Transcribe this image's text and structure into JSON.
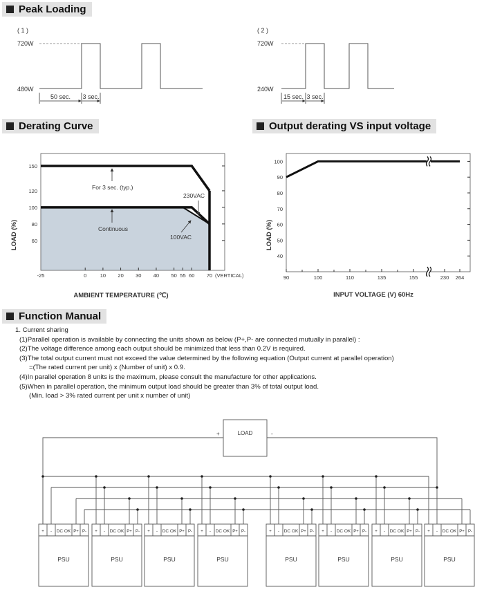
{
  "sections": {
    "peak_loading": "Peak Loading",
    "derating_curve": "Derating Curve",
    "output_derating": "Output derating VS input voltage",
    "function_manual": "Function Manual"
  },
  "peak_loading": [
    {
      "label": "( 1 )",
      "high": "720W",
      "low": "480W",
      "low_duration": "50 sec.",
      "peak_duration": "3 sec."
    },
    {
      "label": "( 2 )",
      "high": "720W",
      "low": "240W",
      "low_duration": "15 sec.",
      "peak_duration": "3 sec."
    }
  ],
  "chart_data": [
    {
      "type": "line",
      "title": "Derating Curve",
      "xlabel": "AMBIENT TEMPERATURE (℃)",
      "ylabel": "LOAD (%)",
      "x_ticks": [
        -25,
        0,
        10,
        20,
        30,
        40,
        50,
        55,
        60,
        70
      ],
      "x_tick_suffix": "(VERTICAL)",
      "y_ticks": [
        60,
        80,
        100,
        120,
        150
      ],
      "xlim": [
        -25,
        70
      ],
      "ylim": [
        24,
        165
      ],
      "series": [
        {
          "name": "For 3 sec. (typ.)",
          "points": [
            [
              -25,
              150
            ],
            [
              60,
              150
            ],
            [
              70,
              120
            ]
          ]
        },
        {
          "name": "230VAC",
          "points": [
            [
              -25,
              100
            ],
            [
              60,
              100
            ],
            [
              70,
              80
            ]
          ]
        },
        {
          "name": "100VAC",
          "points": [
            [
              55,
              100
            ],
            [
              70,
              80
            ]
          ]
        }
      ],
      "shaded_region": "Continuous",
      "annotations": [
        "For 3 sec. (typ.)",
        "Continuous",
        "230VAC",
        "100VAC"
      ],
      "shade_color": "#c9d3dd"
    },
    {
      "type": "line",
      "title": "Output derating VS input voltage",
      "xlabel": "INPUT VOLTAGE (V) 60Hz",
      "ylabel": "LOAD (%)",
      "x_ticks": [
        "90",
        "100",
        "110",
        "135",
        "155",
        "230",
        "264"
      ],
      "y_ticks": [
        40,
        50,
        60,
        70,
        80,
        90,
        100
      ],
      "ylim": [
        30,
        105
      ],
      "axis_break": "between 155 and 230",
      "series": [
        {
          "points": [
            [
              "90",
              90
            ],
            [
              "100",
              100
            ],
            [
              "264",
              100
            ]
          ]
        }
      ]
    }
  ],
  "function_manual": {
    "heading": "1. Current sharing",
    "items": [
      "(1)Parallel operation is available by connecting the units shown as below (P+,P- are connected mutually in parallel) :",
      "(2)The voltage difference among each output should be minimized that less than 0.2V is required.",
      "(3)The total output current must not exceed the value determined by the following equation (Output current at parallel operation)",
      "=(The rated current per unit) x (Number of unit) x 0.9.",
      "(4)In parallel operation 8 units is the maximum, please consult the manufacture for other applications.",
      "(5)When in parallel operation, the minimum output load should be greater than 3% of total output load.",
      "(Min. load > 3% rated current per unit x number of unit)"
    ]
  },
  "diagram": {
    "load_label": "LOAD",
    "plus": "+",
    "minus": "-",
    "psu_label": "PSU",
    "psu_count": 8,
    "terminals": [
      "+",
      "-",
      "DC OK",
      "P+",
      "P-"
    ]
  }
}
